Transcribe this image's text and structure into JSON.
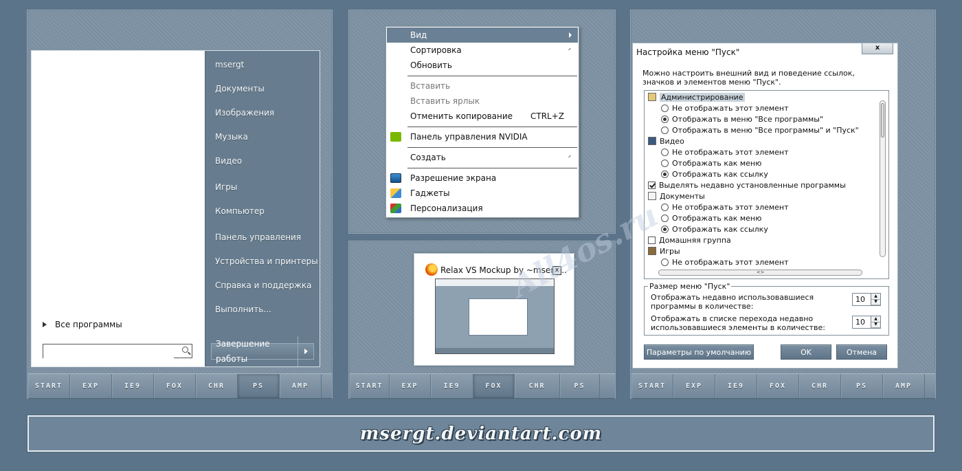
{
  "start_menu": {
    "right_items": [
      "msergt",
      "Документы",
      "Изображения",
      "Музыка",
      "Видео",
      "Игры",
      "Компьютер",
      "Панель управления",
      "Устройства и принтеры",
      "Справка и поддержка",
      "Выполнить..."
    ],
    "all_programs": "Все программы",
    "search_placeholder": "",
    "shutdown": "Завершение работы"
  },
  "taskbar_left": [
    "START",
    "EXP",
    "IE9",
    "FOX",
    "CHR",
    "PS",
    "AMP"
  ],
  "taskbar_mid": [
    "START",
    "EXP",
    "IE9",
    "FOX",
    "CHR",
    "PS"
  ],
  "taskbar_right": [
    "START",
    "EXP",
    "IE9",
    "FOX",
    "CHR",
    "PS",
    "AMP"
  ],
  "context_menu": {
    "view": "Вид",
    "sort": "Сортировка",
    "refresh": "Обновить",
    "paste": "Вставить",
    "paste_shortcut": "Вставить ярлык",
    "undo_copy": "Отменить копирование",
    "undo_copy_key": "CTRL+Z",
    "nvidia": "Панель управления NVIDIA",
    "create": "Создать",
    "resolution": "Разрешение экрана",
    "gadgets": "Гаджеты",
    "personalize": "Персонализация"
  },
  "thumbnail": {
    "title": "Relax VS Mockup by ~mserg...",
    "close": "x"
  },
  "dialog": {
    "title": "Настройка меню \"Пуск\"",
    "close": "x",
    "description": "Можно настроить внешний вид и поведение ссылок, значков и элементов меню \"Пуск\".",
    "tree": {
      "admin": "Администрирование",
      "admin_opt1": "Не отображать этот элемент",
      "admin_opt2": "Отображать в меню \"Все программы\"",
      "admin_opt3": "Отображать в меню \"Все программы\" и \"Пуск\"",
      "video": "Видео",
      "video_opt1": "Не отображать этот элемент",
      "video_opt2": "Отображать как меню",
      "video_opt3": "Отображать как ссылку",
      "highlight": "Выделять недавно установленные программы",
      "docs": "Документы",
      "docs_opt1": "Не отображать этот элемент",
      "docs_opt2": "Отображать как меню",
      "docs_opt3": "Отображать как ссылку",
      "homegroup": "Домашняя группа",
      "games": "Игры",
      "games_opt1": "Не отображать этот элемент",
      "hscroll": "<>"
    },
    "size_legend": "Размер меню \"Пуск\"",
    "recent_programs_label": "Отображать недавно использовавшиеся программы в количестве:",
    "recent_programs_value": "10",
    "jumplist_label": "Отображать в списке перехода недавно использовавшиеся элементы в количестве:",
    "jumplist_value": "10",
    "btn_defaults": "Параметры по умолчанию",
    "btn_ok": "OK",
    "btn_cancel": "Отмена"
  },
  "banner": "msergt.deviantart.com",
  "watermark": "All4os.ru"
}
